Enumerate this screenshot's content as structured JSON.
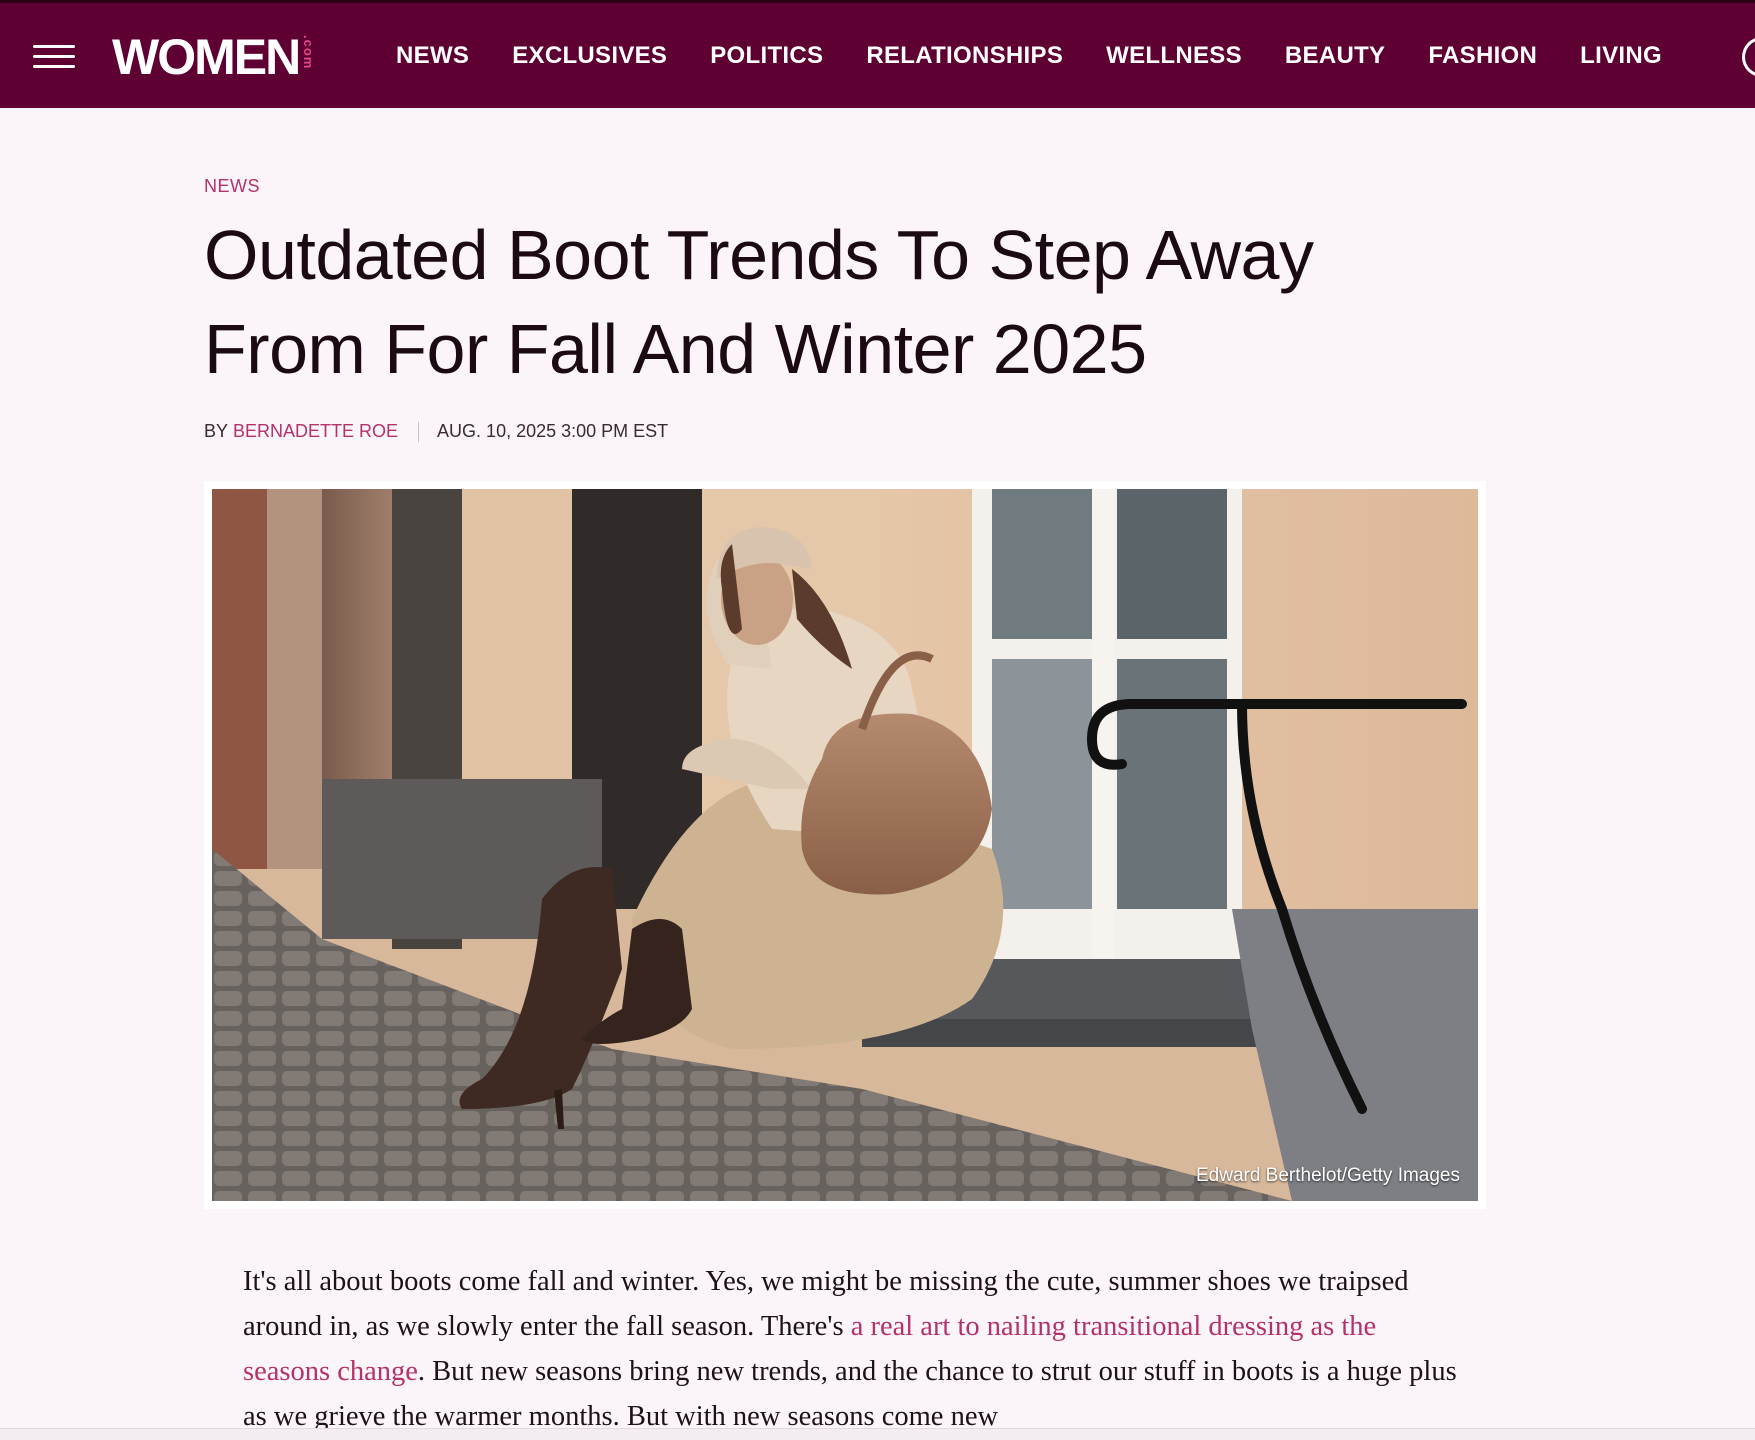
{
  "header": {
    "logo_text": "WOMEN",
    "logo_suffix": ".com",
    "nav": [
      "NEWS",
      "EXCLUSIVES",
      "POLITICS",
      "RELATIONSHIPS",
      "WELLNESS",
      "BEAUTY",
      "FASHION",
      "LIVING"
    ],
    "bg_color": "#5e0031"
  },
  "article": {
    "category": "NEWS",
    "title_line1": "Outdated Boot Trends To Step Away",
    "title_line2": "From For Fall And Winter 2025",
    "byline_prefix": "BY",
    "author": "BERNADETTE ROE",
    "date": "AUG. 10, 2025 3:00 PM EST",
    "image_credit": "Edward Berthelot/Getty Images",
    "body": {
      "part1": "It's all about boots come fall and winter. Yes, we might be missing the cute, summer shoes we traipsed around in, as we slowly enter the fall season. There's ",
      "link": "a real art to nailing transitional dressing as the seasons change",
      "part2": ". But new seasons bring new trends, and the chance to strut our stuff in boots is a huge plus as we grieve the warmer months. But with new seasons come new"
    },
    "accent_color": "#b3326b"
  },
  "icons": {
    "menu": "hamburger-icon",
    "edge": "search-icon"
  }
}
